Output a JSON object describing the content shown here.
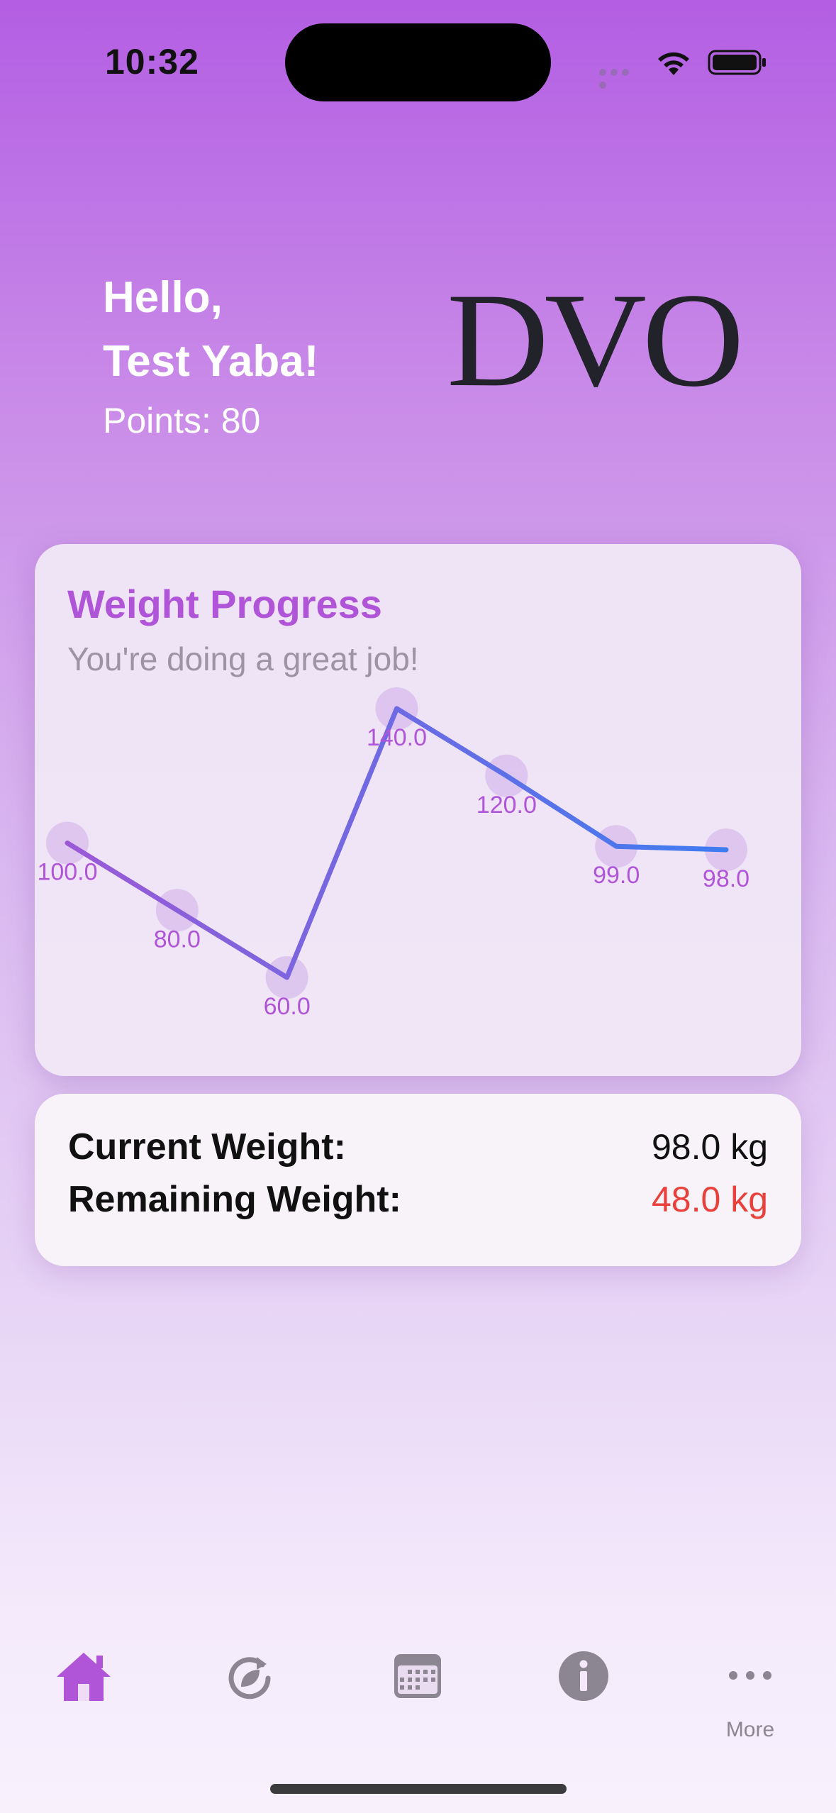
{
  "status_bar": {
    "time": "10:32"
  },
  "greeting": {
    "line1": "Hello,",
    "line2": "Test Yaba!",
    "points": "Points: 80"
  },
  "logo": {
    "text": "DVO"
  },
  "chart_card": {
    "title": "Weight Progress",
    "subtitle": "You're doing a great job!"
  },
  "chart_data": {
    "type": "line",
    "values": [
      100.0,
      80.0,
      60.0,
      140.0,
      120.0,
      99.0,
      98.0
    ],
    "value_labels": [
      "100.0",
      "80.0",
      "60.0",
      "140.0",
      "120.0",
      "99.0",
      "98.0"
    ],
    "colors": {
      "start": "#9b59d6",
      "end": "#3f7cf0",
      "label": "#b055d8"
    }
  },
  "stats": {
    "current_label": "Current Weight:",
    "current_value": "98.0 kg",
    "remaining_label": "Remaining Weight:",
    "remaining_value": "48.0 kg"
  },
  "tab_bar": {
    "items": [
      {
        "icon": "home-icon",
        "label": ""
      },
      {
        "icon": "refresh-leaf-icon",
        "label": ""
      },
      {
        "icon": "calendar-icon",
        "label": ""
      },
      {
        "icon": "info-icon",
        "label": ""
      },
      {
        "icon": "more-icon",
        "label": "More"
      }
    ],
    "active_color": "#b055d8",
    "inactive_color": "#8c8592"
  }
}
